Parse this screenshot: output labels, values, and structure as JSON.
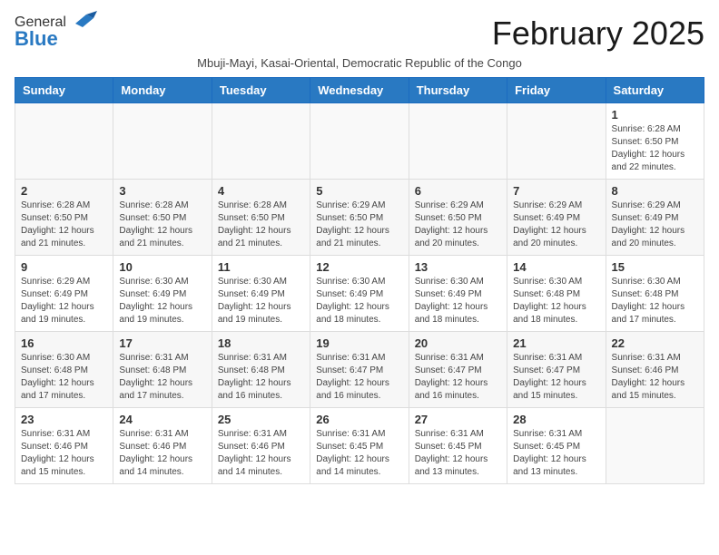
{
  "header": {
    "logo_general": "General",
    "logo_blue": "Blue",
    "month_title": "February 2025",
    "subtitle": "Mbuji-Mayi, Kasai-Oriental, Democratic Republic of the Congo"
  },
  "weekdays": [
    "Sunday",
    "Monday",
    "Tuesday",
    "Wednesday",
    "Thursday",
    "Friday",
    "Saturday"
  ],
  "weeks": [
    {
      "days": [
        {
          "num": "",
          "info": ""
        },
        {
          "num": "",
          "info": ""
        },
        {
          "num": "",
          "info": ""
        },
        {
          "num": "",
          "info": ""
        },
        {
          "num": "",
          "info": ""
        },
        {
          "num": "",
          "info": ""
        },
        {
          "num": "1",
          "info": "Sunrise: 6:28 AM\nSunset: 6:50 PM\nDaylight: 12 hours\nand 22 minutes."
        }
      ]
    },
    {
      "days": [
        {
          "num": "2",
          "info": "Sunrise: 6:28 AM\nSunset: 6:50 PM\nDaylight: 12 hours\nand 21 minutes."
        },
        {
          "num": "3",
          "info": "Sunrise: 6:28 AM\nSunset: 6:50 PM\nDaylight: 12 hours\nand 21 minutes."
        },
        {
          "num": "4",
          "info": "Sunrise: 6:28 AM\nSunset: 6:50 PM\nDaylight: 12 hours\nand 21 minutes."
        },
        {
          "num": "5",
          "info": "Sunrise: 6:29 AM\nSunset: 6:50 PM\nDaylight: 12 hours\nand 21 minutes."
        },
        {
          "num": "6",
          "info": "Sunrise: 6:29 AM\nSunset: 6:50 PM\nDaylight: 12 hours\nand 20 minutes."
        },
        {
          "num": "7",
          "info": "Sunrise: 6:29 AM\nSunset: 6:49 PM\nDaylight: 12 hours\nand 20 minutes."
        },
        {
          "num": "8",
          "info": "Sunrise: 6:29 AM\nSunset: 6:49 PM\nDaylight: 12 hours\nand 20 minutes."
        }
      ]
    },
    {
      "days": [
        {
          "num": "9",
          "info": "Sunrise: 6:29 AM\nSunset: 6:49 PM\nDaylight: 12 hours\nand 19 minutes."
        },
        {
          "num": "10",
          "info": "Sunrise: 6:30 AM\nSunset: 6:49 PM\nDaylight: 12 hours\nand 19 minutes."
        },
        {
          "num": "11",
          "info": "Sunrise: 6:30 AM\nSunset: 6:49 PM\nDaylight: 12 hours\nand 19 minutes."
        },
        {
          "num": "12",
          "info": "Sunrise: 6:30 AM\nSunset: 6:49 PM\nDaylight: 12 hours\nand 18 minutes."
        },
        {
          "num": "13",
          "info": "Sunrise: 6:30 AM\nSunset: 6:49 PM\nDaylight: 12 hours\nand 18 minutes."
        },
        {
          "num": "14",
          "info": "Sunrise: 6:30 AM\nSunset: 6:48 PM\nDaylight: 12 hours\nand 18 minutes."
        },
        {
          "num": "15",
          "info": "Sunrise: 6:30 AM\nSunset: 6:48 PM\nDaylight: 12 hours\nand 17 minutes."
        }
      ]
    },
    {
      "days": [
        {
          "num": "16",
          "info": "Sunrise: 6:30 AM\nSunset: 6:48 PM\nDaylight: 12 hours\nand 17 minutes."
        },
        {
          "num": "17",
          "info": "Sunrise: 6:31 AM\nSunset: 6:48 PM\nDaylight: 12 hours\nand 17 minutes."
        },
        {
          "num": "18",
          "info": "Sunrise: 6:31 AM\nSunset: 6:48 PM\nDaylight: 12 hours\nand 16 minutes."
        },
        {
          "num": "19",
          "info": "Sunrise: 6:31 AM\nSunset: 6:47 PM\nDaylight: 12 hours\nand 16 minutes."
        },
        {
          "num": "20",
          "info": "Sunrise: 6:31 AM\nSunset: 6:47 PM\nDaylight: 12 hours\nand 16 minutes."
        },
        {
          "num": "21",
          "info": "Sunrise: 6:31 AM\nSunset: 6:47 PM\nDaylight: 12 hours\nand 15 minutes."
        },
        {
          "num": "22",
          "info": "Sunrise: 6:31 AM\nSunset: 6:46 PM\nDaylight: 12 hours\nand 15 minutes."
        }
      ]
    },
    {
      "days": [
        {
          "num": "23",
          "info": "Sunrise: 6:31 AM\nSunset: 6:46 PM\nDaylight: 12 hours\nand 15 minutes."
        },
        {
          "num": "24",
          "info": "Sunrise: 6:31 AM\nSunset: 6:46 PM\nDaylight: 12 hours\nand 14 minutes."
        },
        {
          "num": "25",
          "info": "Sunrise: 6:31 AM\nSunset: 6:46 PM\nDaylight: 12 hours\nand 14 minutes."
        },
        {
          "num": "26",
          "info": "Sunrise: 6:31 AM\nSunset: 6:45 PM\nDaylight: 12 hours\nand 14 minutes."
        },
        {
          "num": "27",
          "info": "Sunrise: 6:31 AM\nSunset: 6:45 PM\nDaylight: 12 hours\nand 13 minutes."
        },
        {
          "num": "28",
          "info": "Sunrise: 6:31 AM\nSunset: 6:45 PM\nDaylight: 12 hours\nand 13 minutes."
        },
        {
          "num": "",
          "info": ""
        }
      ]
    }
  ]
}
